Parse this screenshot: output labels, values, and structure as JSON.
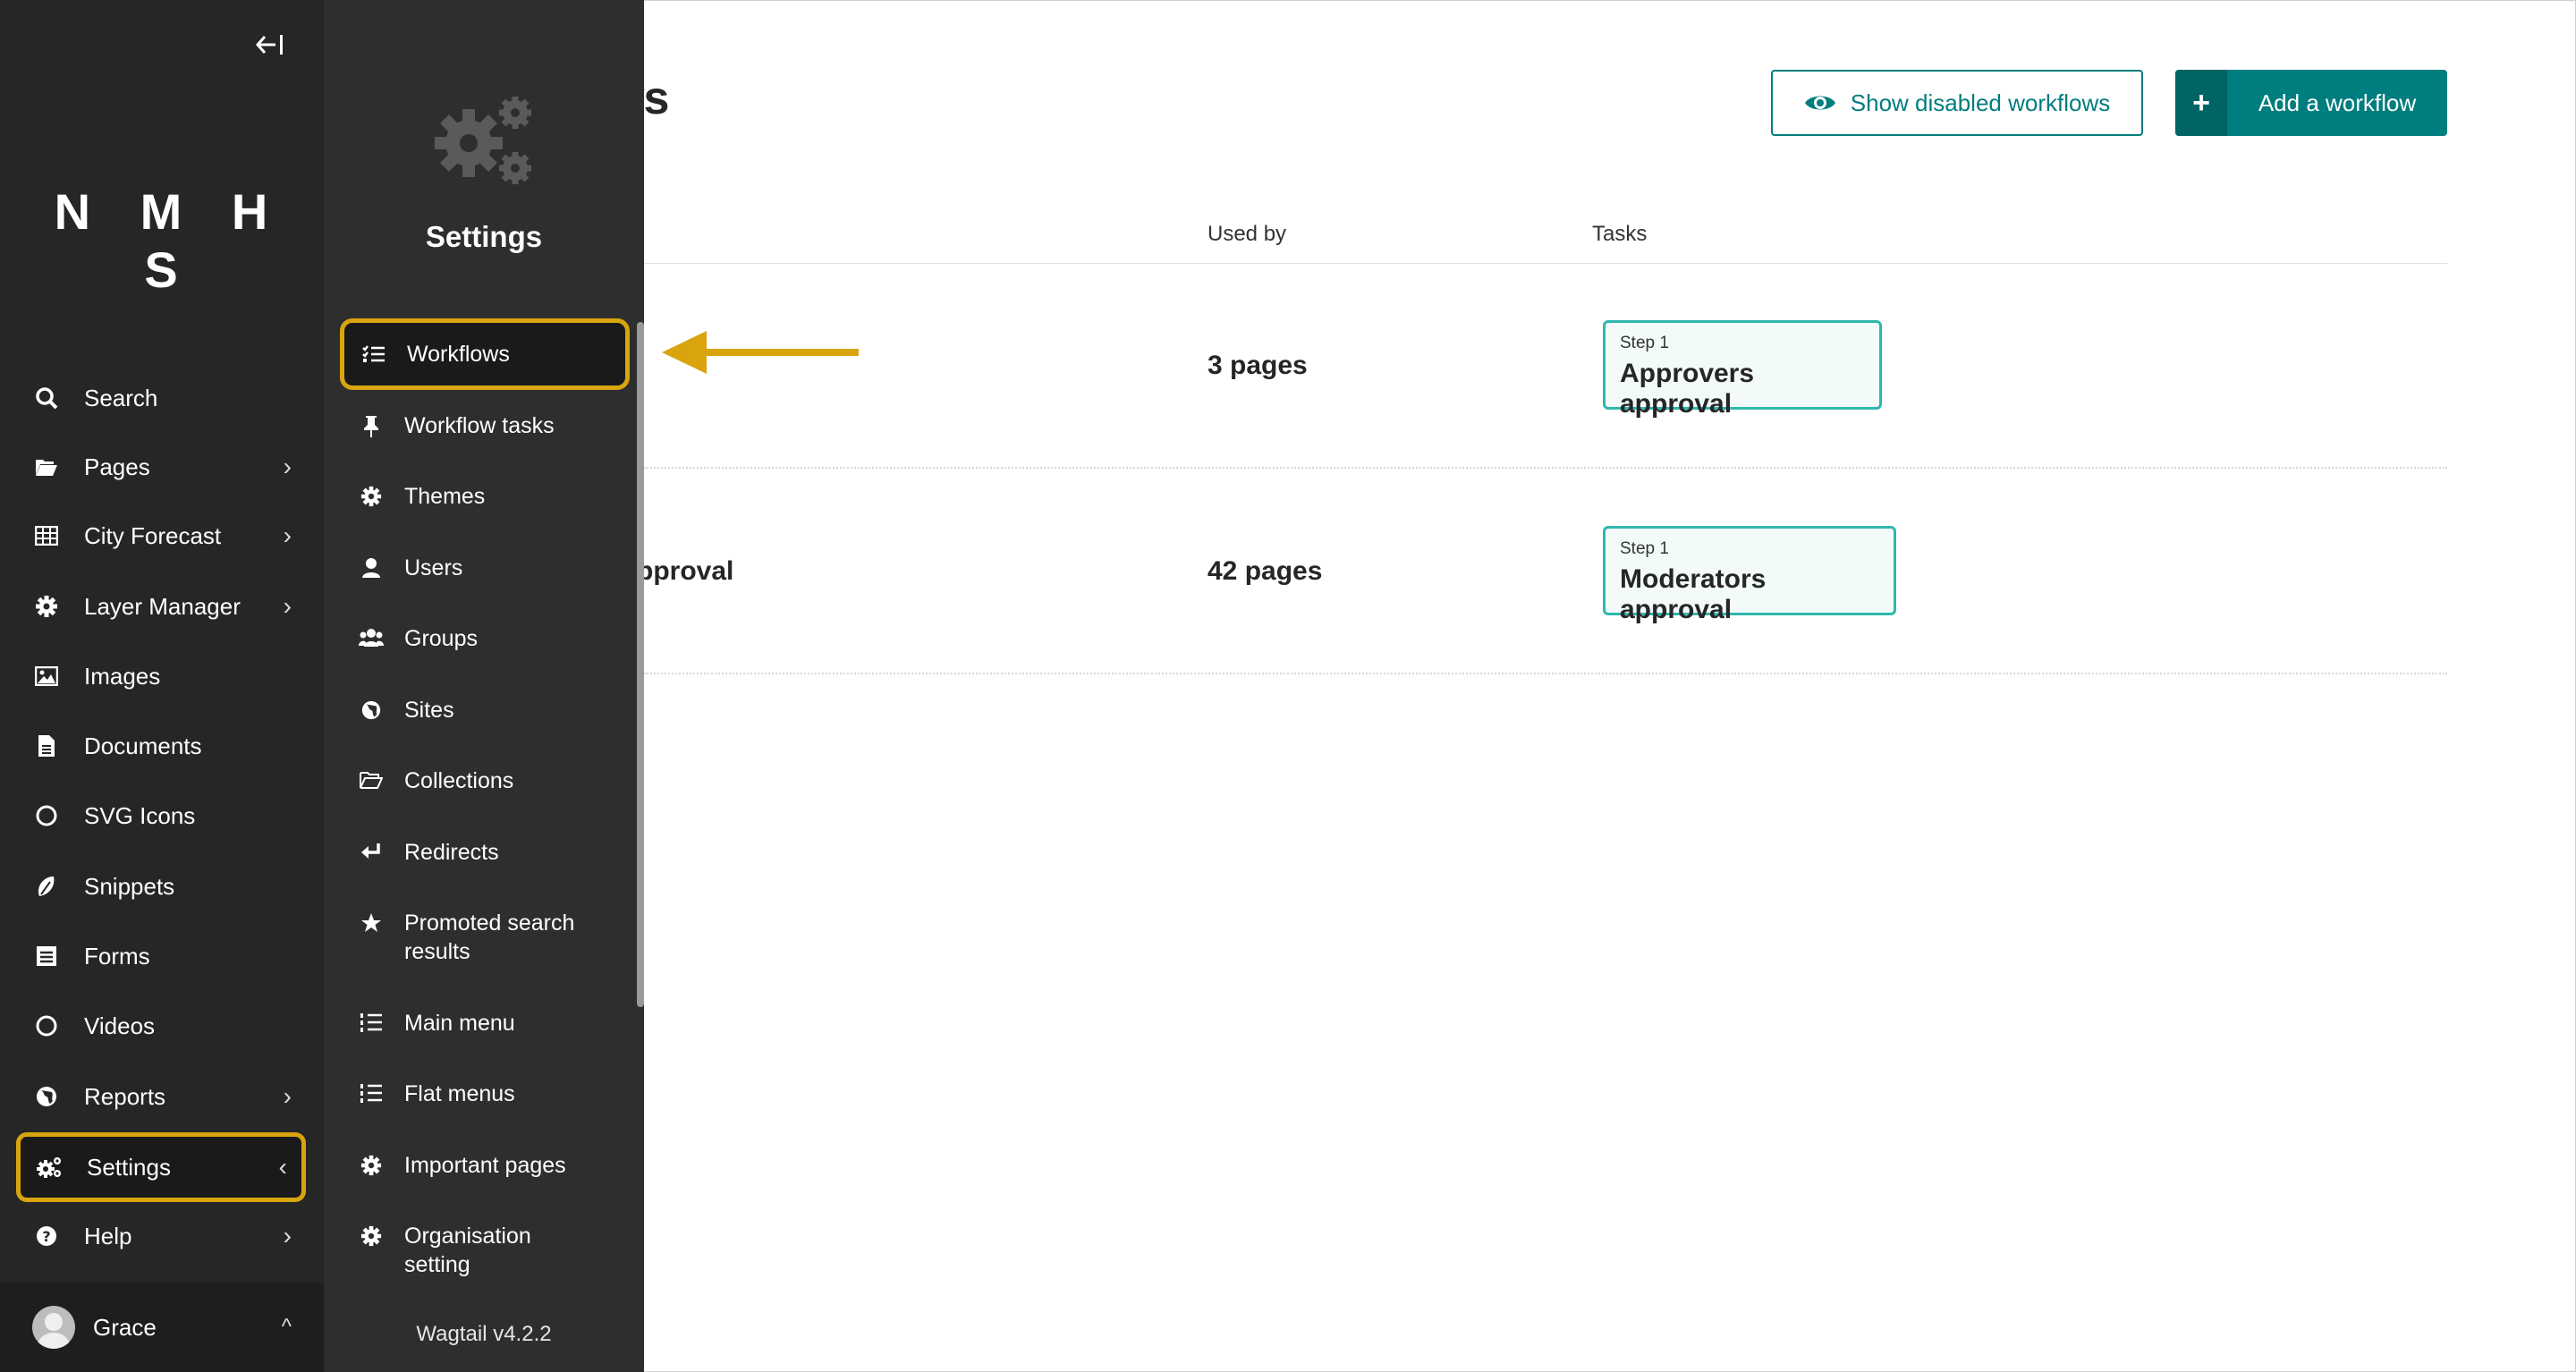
{
  "sidebar": {
    "logo": "N M H S",
    "items": [
      {
        "label": "Search",
        "icon": "search-icon"
      },
      {
        "label": "Pages",
        "icon": "folder-open-icon",
        "chevron": "›"
      },
      {
        "label": "City Forecast",
        "icon": "table-icon",
        "chevron": "›"
      },
      {
        "label": "Layer Manager",
        "icon": "cog-icon",
        "chevron": "›"
      },
      {
        "label": "Images",
        "icon": "image-icon"
      },
      {
        "label": "Documents",
        "icon": "document-icon"
      },
      {
        "label": "SVG Icons",
        "icon": "circle-icon"
      },
      {
        "label": "Snippets",
        "icon": "snippet-icon"
      },
      {
        "label": "Forms",
        "icon": "form-icon"
      },
      {
        "label": "Videos",
        "icon": "circle-icon"
      },
      {
        "label": "Reports",
        "icon": "globe-icon",
        "chevron": "›"
      },
      {
        "label": "Settings",
        "icon": "cogs-icon",
        "chevron": "‹"
      },
      {
        "label": "Help",
        "icon": "help-icon",
        "chevron": "›"
      }
    ],
    "account": {
      "name": "Grace",
      "chevron": "^"
    }
  },
  "submenu": {
    "title": "Settings",
    "items": [
      {
        "label": "Workflows",
        "icon": "tasks-icon"
      },
      {
        "label": "Workflow tasks",
        "icon": "thumbtack-icon"
      },
      {
        "label": "Themes",
        "icon": "cog-icon"
      },
      {
        "label": "Users",
        "icon": "user-icon"
      },
      {
        "label": "Groups",
        "icon": "group-icon"
      },
      {
        "label": "Sites",
        "icon": "globe-icon"
      },
      {
        "label": "Collections",
        "icon": "folder-open-icon"
      },
      {
        "label": "Redirects",
        "icon": "redirect-icon"
      },
      {
        "label": "Promoted search results",
        "icon": "star-icon"
      },
      {
        "label": "Main menu",
        "icon": "list-ol-icon"
      },
      {
        "label": "Flat menus",
        "icon": "list-ol-icon"
      },
      {
        "label": "Important pages",
        "icon": "cog-icon"
      },
      {
        "label": "Organisation setting",
        "icon": "cog-icon"
      }
    ],
    "version": "Wagtail v4.2.2"
  },
  "main": {
    "title_visible": "ws",
    "buttons": {
      "show_disabled": "Show disabled workflows",
      "add_workflow": "Add a workflow",
      "add_icon": "+"
    },
    "table": {
      "headers": {
        "used_by": "Used by",
        "tasks": "Tasks"
      },
      "rows": [
        {
          "name_visible": "",
          "used_by": "3 pages",
          "task_step": "Step 1",
          "task_name": "Approvers approval"
        },
        {
          "name_visible": "pproval",
          "used_by": "42 pages",
          "task_step": "Step 1",
          "task_name": "Moderators approval"
        }
      ]
    }
  },
  "colors": {
    "accent": "#007d7e",
    "highlight": "#d9a40e",
    "sidebar": "#262626",
    "submenu": "#2e2e2e",
    "arrow": "#d9a40e"
  }
}
